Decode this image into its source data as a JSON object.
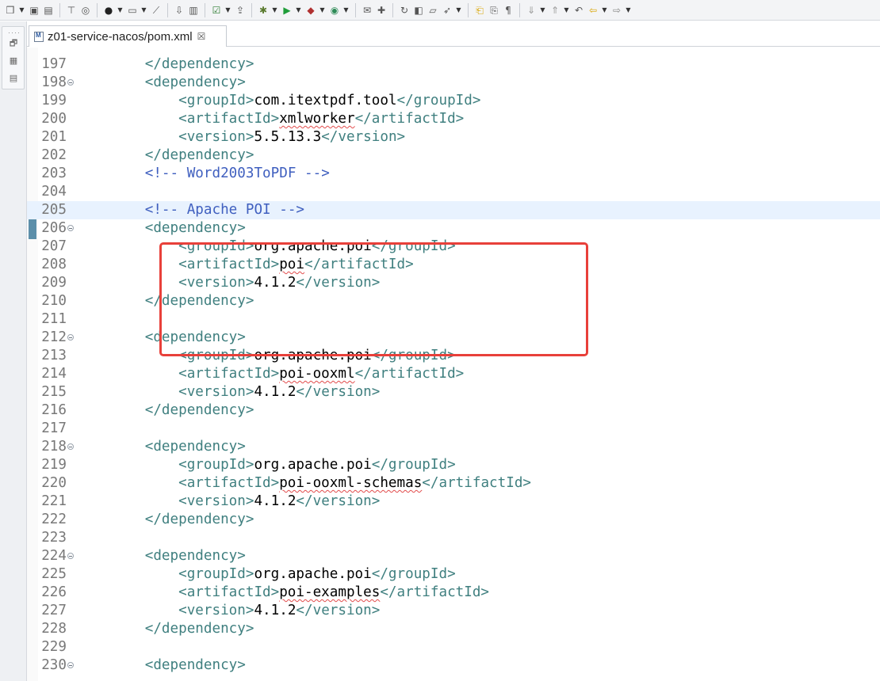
{
  "toolbar": {
    "icons": [
      "new-wizard-icon",
      "save-icon",
      "save-all-icon",
      "open-type-icon",
      "open-resource-icon",
      "person-icon",
      "terminal-icon",
      "pin-icon",
      "import-icon",
      "server-icon",
      "task-check-icon",
      "publish-icon",
      "debug-icon",
      "run-icon",
      "run-external-icon",
      "coverage-icon",
      "open-folder-icon",
      "package-icon",
      "refresh-icon",
      "open-project-icon",
      "folder-icon",
      "launch-icon",
      "annotation-prev-icon",
      "annotation-next-icon",
      "toggle-mark-icon",
      "down-icon",
      "up-icon",
      "last-edit-icon",
      "back-icon",
      "forward-icon"
    ]
  },
  "tab": {
    "title": "z01-service-nacos/pom.xml",
    "close_glyph": "☒"
  },
  "lines": [
    {
      "n": "197",
      "current": false,
      "fold": false,
      "ind": "        ",
      "segs": [
        {
          "t": "</dependency>",
          "c": "tag"
        }
      ]
    },
    {
      "n": "198",
      "current": false,
      "fold": true,
      "ind": "        ",
      "segs": [
        {
          "t": "<dependency>",
          "c": "tag"
        }
      ]
    },
    {
      "n": "199",
      "current": false,
      "fold": false,
      "ind": "            ",
      "segs": [
        {
          "t": "<groupId>",
          "c": "tag"
        },
        {
          "t": "com.itextpdf.tool",
          "c": "val"
        },
        {
          "t": "</groupId>",
          "c": "tag"
        }
      ]
    },
    {
      "n": "200",
      "current": false,
      "fold": false,
      "ind": "            ",
      "segs": [
        {
          "t": "<artifactId>",
          "c": "tag"
        },
        {
          "t": "xmlworker",
          "c": "val sq"
        },
        {
          "t": "</artifactId>",
          "c": "tag"
        }
      ]
    },
    {
      "n": "201",
      "current": false,
      "fold": false,
      "ind": "            ",
      "segs": [
        {
          "t": "<version>",
          "c": "tag"
        },
        {
          "t": "5.5.13.3",
          "c": "val"
        },
        {
          "t": "</version>",
          "c": "tag"
        }
      ]
    },
    {
      "n": "202",
      "current": false,
      "fold": false,
      "ind": "        ",
      "segs": [
        {
          "t": "</dependency>",
          "c": "tag"
        }
      ]
    },
    {
      "n": "203",
      "current": false,
      "fold": false,
      "ind": "        ",
      "segs": [
        {
          "t": "<!-- Word2003ToPDF -->",
          "c": "cmt"
        }
      ]
    },
    {
      "n": "204",
      "current": false,
      "fold": false,
      "ind": "",
      "segs": []
    },
    {
      "n": "205",
      "current": true,
      "fold": false,
      "ind": "        ",
      "segs": [
        {
          "t": "<!-- Apache POI -->",
          "c": "cmt"
        }
      ]
    },
    {
      "n": "206",
      "current": false,
      "fold": true,
      "ind": "        ",
      "segs": [
        {
          "t": "<dependency>",
          "c": "tag"
        }
      ]
    },
    {
      "n": "207",
      "current": false,
      "fold": false,
      "ind": "            ",
      "segs": [
        {
          "t": "<groupId>",
          "c": "tag"
        },
        {
          "t": "org.apache.poi",
          "c": "val"
        },
        {
          "t": "</groupId>",
          "c": "tag"
        }
      ]
    },
    {
      "n": "208",
      "current": false,
      "fold": false,
      "ind": "            ",
      "segs": [
        {
          "t": "<artifactId>",
          "c": "tag"
        },
        {
          "t": "poi",
          "c": "val sq"
        },
        {
          "t": "</artifactId>",
          "c": "tag"
        }
      ]
    },
    {
      "n": "209",
      "current": false,
      "fold": false,
      "ind": "            ",
      "segs": [
        {
          "t": "<version>",
          "c": "tag"
        },
        {
          "t": "4.1.2",
          "c": "val"
        },
        {
          "t": "</version>",
          "c": "tag"
        }
      ]
    },
    {
      "n": "210",
      "current": false,
      "fold": false,
      "ind": "        ",
      "segs": [
        {
          "t": "</dependency>",
          "c": "tag"
        }
      ]
    },
    {
      "n": "211",
      "current": false,
      "fold": false,
      "ind": "",
      "segs": []
    },
    {
      "n": "212",
      "current": false,
      "fold": true,
      "ind": "        ",
      "segs": [
        {
          "t": "<dependency>",
          "c": "tag"
        }
      ]
    },
    {
      "n": "213",
      "current": false,
      "fold": false,
      "ind": "            ",
      "segs": [
        {
          "t": "<groupId>",
          "c": "tag"
        },
        {
          "t": "org.apache.poi",
          "c": "val"
        },
        {
          "t": "</groupId>",
          "c": "tag"
        }
      ]
    },
    {
      "n": "214",
      "current": false,
      "fold": false,
      "ind": "            ",
      "segs": [
        {
          "t": "<artifactId>",
          "c": "tag"
        },
        {
          "t": "poi-ooxml",
          "c": "val sq"
        },
        {
          "t": "</artifactId>",
          "c": "tag"
        }
      ]
    },
    {
      "n": "215",
      "current": false,
      "fold": false,
      "ind": "            ",
      "segs": [
        {
          "t": "<version>",
          "c": "tag"
        },
        {
          "t": "4.1.2",
          "c": "val"
        },
        {
          "t": "</version>",
          "c": "tag"
        }
      ]
    },
    {
      "n": "216",
      "current": false,
      "fold": false,
      "ind": "        ",
      "segs": [
        {
          "t": "</dependency>",
          "c": "tag"
        }
      ]
    },
    {
      "n": "217",
      "current": false,
      "fold": false,
      "ind": "",
      "segs": []
    },
    {
      "n": "218",
      "current": false,
      "fold": true,
      "ind": "        ",
      "segs": [
        {
          "t": "<dependency>",
          "c": "tag"
        }
      ]
    },
    {
      "n": "219",
      "current": false,
      "fold": false,
      "ind": "            ",
      "segs": [
        {
          "t": "<groupId>",
          "c": "tag"
        },
        {
          "t": "org.apache.poi",
          "c": "val"
        },
        {
          "t": "</groupId>",
          "c": "tag"
        }
      ]
    },
    {
      "n": "220",
      "current": false,
      "fold": false,
      "ind": "            ",
      "segs": [
        {
          "t": "<artifactId>",
          "c": "tag"
        },
        {
          "t": "poi-ooxml-schemas",
          "c": "val sq"
        },
        {
          "t": "</artifactId>",
          "c": "tag"
        }
      ]
    },
    {
      "n": "221",
      "current": false,
      "fold": false,
      "ind": "            ",
      "segs": [
        {
          "t": "<version>",
          "c": "tag"
        },
        {
          "t": "4.1.2",
          "c": "val"
        },
        {
          "t": "</version>",
          "c": "tag"
        }
      ]
    },
    {
      "n": "222",
      "current": false,
      "fold": false,
      "ind": "        ",
      "segs": [
        {
          "t": "</dependency>",
          "c": "tag"
        }
      ]
    },
    {
      "n": "223",
      "current": false,
      "fold": false,
      "ind": "",
      "segs": []
    },
    {
      "n": "224",
      "current": false,
      "fold": true,
      "ind": "        ",
      "segs": [
        {
          "t": "<dependency>",
          "c": "tag"
        }
      ]
    },
    {
      "n": "225",
      "current": false,
      "fold": false,
      "ind": "            ",
      "segs": [
        {
          "t": "<groupId>",
          "c": "tag"
        },
        {
          "t": "org.apache.poi",
          "c": "val"
        },
        {
          "t": "</groupId>",
          "c": "tag"
        }
      ]
    },
    {
      "n": "226",
      "current": false,
      "fold": false,
      "ind": "            ",
      "segs": [
        {
          "t": "<artifactId>",
          "c": "tag"
        },
        {
          "t": "poi-examples",
          "c": "val sq"
        },
        {
          "t": "</artifactId>",
          "c": "tag"
        }
      ]
    },
    {
      "n": "227",
      "current": false,
      "fold": false,
      "ind": "            ",
      "segs": [
        {
          "t": "<version>",
          "c": "tag"
        },
        {
          "t": "4.1.2",
          "c": "val"
        },
        {
          "t": "</version>",
          "c": "tag"
        }
      ]
    },
    {
      "n": "228",
      "current": false,
      "fold": false,
      "ind": "        ",
      "segs": [
        {
          "t": "</dependency>",
          "c": "tag"
        }
      ]
    },
    {
      "n": "229",
      "current": false,
      "fold": false,
      "ind": "",
      "segs": []
    },
    {
      "n": "230",
      "current": false,
      "fold": true,
      "ind": "        ",
      "segs": [
        {
          "t": "<dependency>",
          "c": "tag"
        }
      ]
    }
  ],
  "colors": {
    "tag": "#3f7f7f",
    "comment": "#3f5fbf",
    "current_line": "#e8f2fe",
    "annotation_box": "#e8403a"
  }
}
